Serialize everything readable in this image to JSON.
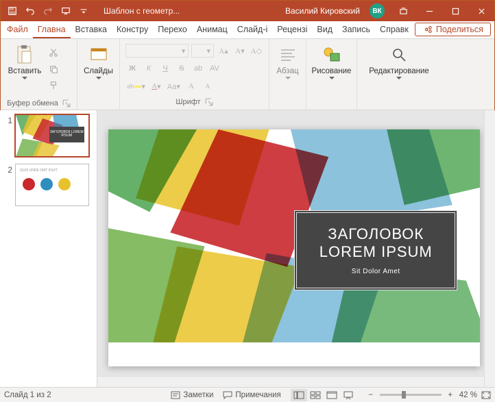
{
  "titlebar": {
    "doc_title": "Шаблон с геометр...",
    "user_name": "Василий Кировский",
    "user_initials": "ВК"
  },
  "tabs": {
    "file": "Файл",
    "home": "Главна",
    "insert": "Вставка",
    "design": "Констру",
    "transitions": "Перехо",
    "animations": "Анимац",
    "slideshow": "Слайд-і",
    "review": "Рецензі",
    "view": "Вид",
    "recording": "Запись",
    "help": "Справк",
    "share": "Поделиться"
  },
  "ribbon": {
    "paste": "Вставить",
    "clipboard_label": "Буфер обмена",
    "slides": "Слайды",
    "font_label": "Шрифт",
    "paragraph": "Абзац",
    "drawing": "Рисование",
    "editing": "Редактирование",
    "bold": "Ж",
    "italic": "К",
    "underline": "Ч",
    "strike": "S"
  },
  "slides": [
    {
      "num": "1"
    },
    {
      "num": "2",
      "header": "QUIS UNDE OMT IDUIT"
    }
  ],
  "slide_content": {
    "title_line1": "ЗАГОЛОВОК",
    "title_line2": "LOREM IPSUM",
    "subtitle": "Sit Dolor Amet",
    "thumb_title": "ЗАГОЛОВОК LOREM IPSUM"
  },
  "statusbar": {
    "slide_info": "Слайд 1 из 2",
    "notes": "Заметки",
    "comments": "Примечания",
    "zoom_value": "42 %"
  },
  "colors": {
    "brand": "#b7472a",
    "teal": "#22a088"
  }
}
